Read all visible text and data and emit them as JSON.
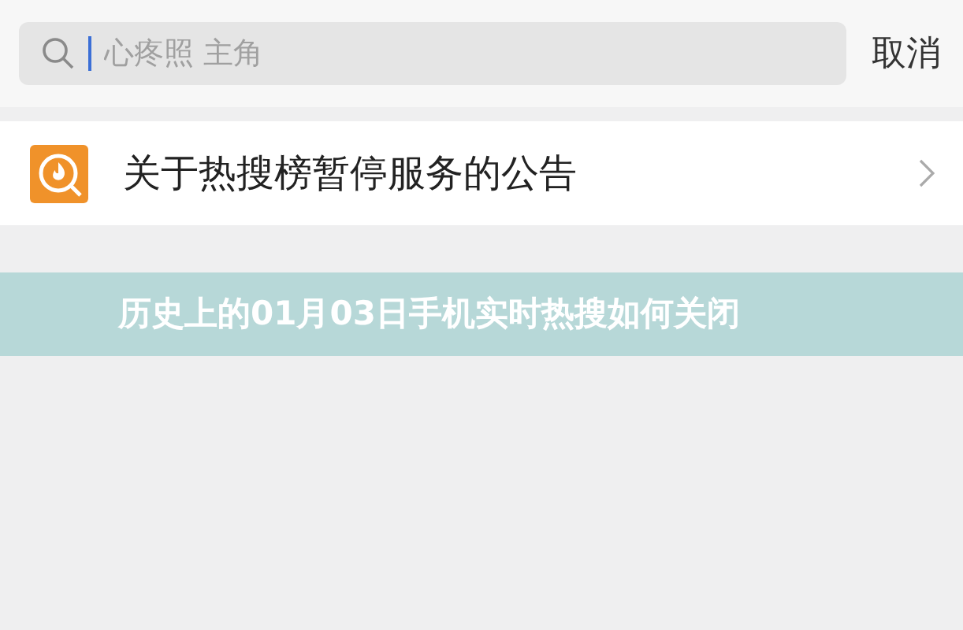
{
  "search": {
    "placeholder": "心疼照 主角"
  },
  "cancel_button": "取消",
  "results": [
    {
      "title": "关于热搜榜暂停服务的公告"
    }
  ],
  "banner": {
    "title": "历史上的01月03日手机实时热搜如何关闭"
  }
}
